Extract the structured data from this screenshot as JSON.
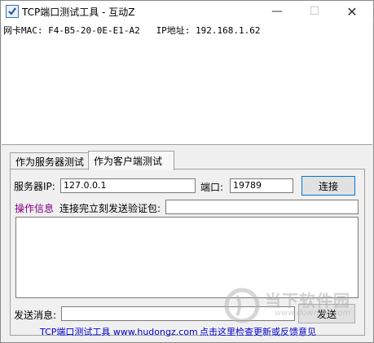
{
  "window": {
    "title": "TCP端口测试工具 - 互动Z",
    "minimize_glyph": "—",
    "maximize_glyph": "☐",
    "close_glyph": "✕"
  },
  "info": {
    "line": "网卡MAC: F4-B5-20-0E-E1-A2   IP地址: 192.168.1.62"
  },
  "tabs": [
    {
      "label": "作为服务器测试",
      "selected": false
    },
    {
      "label": "作为客户端测试",
      "selected": true
    }
  ],
  "client": {
    "server_ip_label": "服务器IP:",
    "server_ip_value": "127.0.0.1",
    "port_label": "端口:",
    "port_value": "19789",
    "connect_label": "连接",
    "op_info_label": "操作信息",
    "verify_label": "连接完立刻发送验证包:",
    "verify_value": "",
    "send_msg_label": "发送消息:",
    "send_msg_value": "",
    "send_label": "发送"
  },
  "footer": {
    "left": "TCP端口测试工具 www.hudongz.com",
    "right": "点击这里检查更新或反馈意见"
  },
  "watermark": {
    "name": "当下软件园",
    "url": "www.downxia.com"
  },
  "colors": {
    "link": "#0000cc",
    "op_info": "#800080",
    "accent": "#0078d7"
  }
}
